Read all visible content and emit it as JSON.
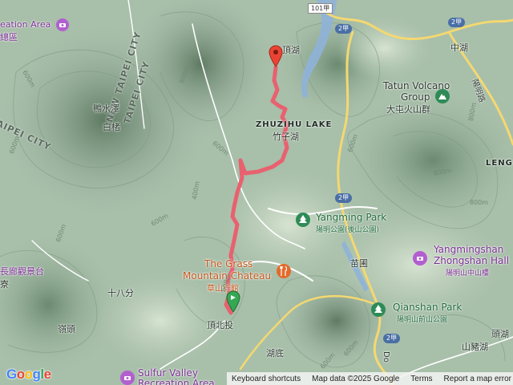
{
  "map": {
    "colors": {
      "route": "#e8616f",
      "start_pin": "#34a853",
      "end_pin": "#ea4335",
      "road_yellow": "#f4d871",
      "road_white": "#ffffff",
      "water": "#a9c8e8"
    },
    "places": {
      "recreation_area": "eation Area",
      "district_qu": "總區",
      "new_taipei_city": "NEW TAIPEI CITY",
      "taipei_city_left": "TAIPEI CITY",
      "taipei_city_right": "TAIPEI CITY",
      "ya_shui_ze": "鴨水澤",
      "bai_jie": "白楮",
      "zhuzihu_lake_en": "ZHUZIHU LAKE",
      "zhuzihu_lake_zh": "竹子湖",
      "ding_hu": "頂湖",
      "tatun_volcano_en1": "Tatun Volcano",
      "tatun_volcano_en2": "Group",
      "tatun_volcano_zh": "大屯火山群",
      "zhonghu": "中湖",
      "leng": "LENG",
      "yangming_park_en": "Yangming Park",
      "yangming_park_zh": "陽明公園(後山公園)",
      "grass_mountain_en1": "The Grass",
      "grass_mountain_en2": "Mountain Chateau",
      "grass_mountain_zh": "草山行館",
      "yangmingshan_hall_en1": "Yangmingshan",
      "yangmingshan_hall_en2": "Zhongshan Hall",
      "yangmingshan_hall_zh": "陽明山中山樓",
      "miao_pu": "苗圃",
      "pavilion": "長廊觀景台",
      "liao": "寮",
      "shi_ba_fen": "十八分",
      "ding_bei_tou": "頂北投",
      "qianshan_park_en": "Qianshan Park",
      "qianshan_park_zh": "陽明山前山公園",
      "ling_tou": "嶺頭",
      "hu_di": "湖底",
      "shan_zhu_hu": "山豬湖",
      "tou_hu": "頭湖",
      "sulfur_valley_en1": "Sulfur Valley",
      "sulfur_valley_en2": "Recreation Area",
      "yangming_road_vertical": "陽明路",
      "yangde_road": "Do"
    },
    "roads": {
      "road_101": "101甲",
      "road_2": "2甲",
      "road_2_b": "2甲",
      "road_2_c": "2甲",
      "road_2_d": "2甲",
      "road_2_top": "2甲",
      "road_2_bottom": "2甲"
    },
    "contours": {
      "c_800a": "800m",
      "c_800b": "800m",
      "c_600a": "600m",
      "c_600b": "600m",
      "c_600c": "600m",
      "c_600d": "600m",
      "c_600e": "600m",
      "c_800c": "800m",
      "c_800d": "800m",
      "c_600f": "600m",
      "c_600g": "600m",
      "c_600h": "600m",
      "c_400": "400m",
      "c_600i": "600m"
    },
    "icons": {
      "park": "tree-icon",
      "attraction": "camera-icon",
      "restaurant": "fork-knife-icon",
      "mountain": "mountain-icon",
      "start": "start-pin-icon",
      "end": "end-pin-icon"
    },
    "attribution": {
      "logo": "Google",
      "keyboard": "Keyboard shortcuts",
      "map_data": "Map data ©2025 Google",
      "terms": "Terms",
      "report": "Report a map error"
    }
  }
}
